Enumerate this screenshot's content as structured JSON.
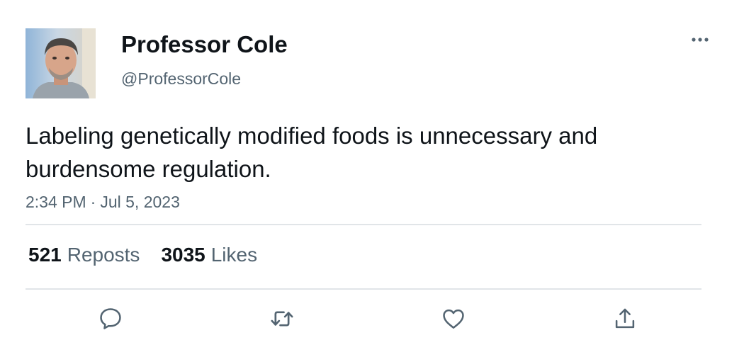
{
  "author": {
    "display_name": "Professor Cole",
    "handle": "@ProfessorCole",
    "avatar_icon": "portrait-photo"
  },
  "tweet": {
    "text": "Labeling genetically modified foods is unnecessary and burdensome regulation.",
    "time": "2:34 PM",
    "separator": "·",
    "date": "Jul 5, 2023"
  },
  "stats": {
    "reposts_count": "521",
    "reposts_label": "Reposts",
    "likes_count": "3035",
    "likes_label": "Likes"
  },
  "actions": [
    {
      "name": "reply",
      "icon": "speech-bubble-icon"
    },
    {
      "name": "repost",
      "icon": "repost-arrows-icon"
    },
    {
      "name": "like",
      "icon": "heart-icon"
    },
    {
      "name": "share",
      "icon": "share-upload-icon"
    }
  ],
  "colors": {
    "text_primary": "#0f1419",
    "text_secondary": "#536471",
    "divider": "#e1e5e8",
    "icon": "#536471"
  }
}
